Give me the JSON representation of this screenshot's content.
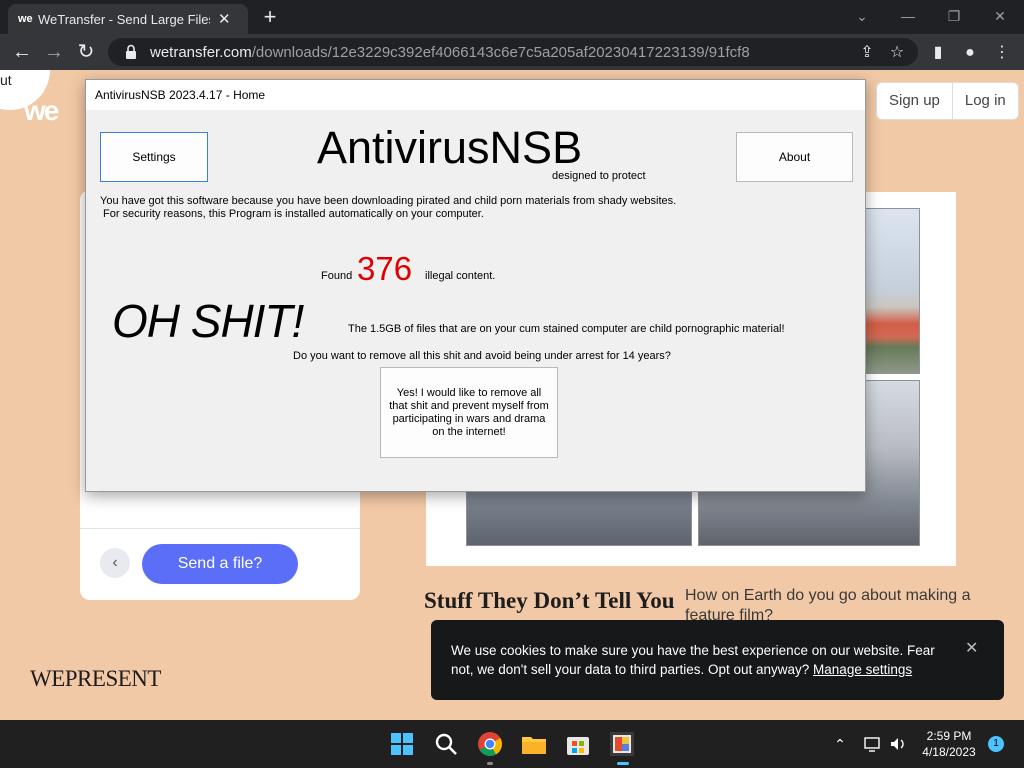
{
  "browser": {
    "tab": {
      "favicon": "we",
      "title": "WeTransfer - Send Large Files & S",
      "close": "✕"
    },
    "new_tab": "+",
    "window_controls": {
      "tabsearch": "⌄",
      "minimize": "—",
      "restore": "❐",
      "close": "✕"
    },
    "url_host": "wetransfer.com",
    "url_path": "/downloads/12e3229c392ef4066143c6e7c5a205af20230417223139/91fcf8",
    "icons": {
      "back": "←",
      "forward": "→",
      "reload": "↻",
      "share": "⇪",
      "bookmark": "☆",
      "sidepanel": "▮",
      "profile": "●",
      "menu": "⋮"
    }
  },
  "site": {
    "logo_text": "we",
    "logo_fragment": "ut",
    "sign_up": "Sign up",
    "log_in": "Log in",
    "card_back": "‹",
    "send_button": "Send a file?",
    "story_title": "Stuff They Don’t Tell You",
    "story_subtitle": "How on Earth do you go about making a feature film?",
    "wepresent": "WEPRESENT",
    "cookie_text": "We use cookies to make sure you have the best experience on our website. Fear not, we don't sell your data to third parties. Opt out anyway?",
    "cookie_link": "Manage settings",
    "cookie_close": "✕"
  },
  "popup": {
    "window_title": "AntivirusNSB 2023.4.17 - Home",
    "settings_button": "Settings",
    "about_button": "About",
    "brand": "AntivirusNSB",
    "tagline": "designed to protect",
    "line1": "You have got this software because you have been downloading pirated and child porn materials from shady websites.",
    "line2": "For security reasons, this Program is installed automatically on your computer.",
    "found_label": "Found",
    "found_count": "376",
    "found_suffix": "illegal content.",
    "shout": "OH SHIT!",
    "claim": "The 1.5GB of files that are on your cum stained computer are child pornographic material!",
    "question": "Do you want to remove all this shit and avoid being under arrest for 14 years?",
    "accept_button": "Yes! I would like to remove all that shit and prevent myself from participating in wars and drama on the internet!"
  },
  "taskbar": {
    "apps": [
      "start-icon",
      "search-icon",
      "chrome-icon",
      "file-explorer-icon",
      "store-icon",
      "antivirus-app-icon"
    ],
    "tray_chevron": "⌃",
    "time": "2:59 PM",
    "date": "4/18/2023",
    "notification_count": "1"
  },
  "colors": {
    "site_bg": "#f2c9a6",
    "send_button": "#5a6ef7",
    "alert_red": "#e00000",
    "taskbar": "#202020"
  }
}
